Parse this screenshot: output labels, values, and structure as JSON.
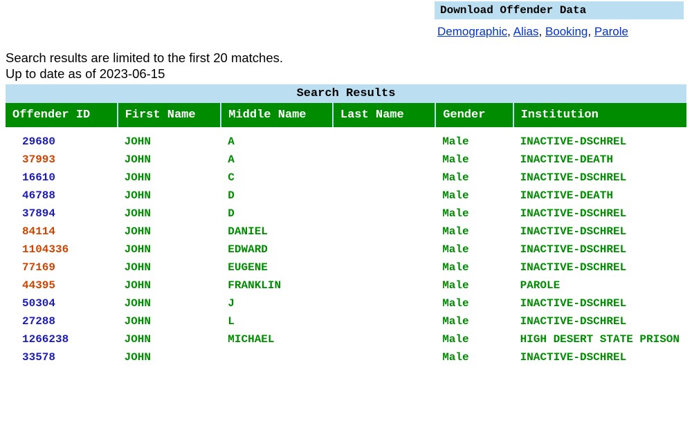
{
  "download": {
    "header": "Download Offender Data",
    "links": [
      {
        "label": "Demographic"
      },
      {
        "label": "Alias"
      },
      {
        "label": "Booking"
      },
      {
        "label": "Parole"
      }
    ]
  },
  "info": {
    "line1": "Search results are limited to the first 20 matches.",
    "line2": "Up to date as of 2023-06-15"
  },
  "results": {
    "title": "Search Results",
    "columns": [
      "Offender ID",
      "First Name",
      "Middle Name",
      "Last Name",
      "Gender",
      "Institution"
    ],
    "rows": [
      {
        "id": "29680",
        "color": "blue",
        "first": "JOHN",
        "middle": "A",
        "last": "",
        "gender": "Male",
        "inst": "INACTIVE-DSCHREL"
      },
      {
        "id": "37993",
        "color": "orange",
        "first": "JOHN",
        "middle": "A",
        "last": "",
        "gender": "Male",
        "inst": "INACTIVE-DEATH"
      },
      {
        "id": "16610",
        "color": "blue",
        "first": "JOHN",
        "middle": "C",
        "last": "",
        "gender": "Male",
        "inst": "INACTIVE-DSCHREL"
      },
      {
        "id": "46788",
        "color": "blue",
        "first": "JOHN",
        "middle": "D",
        "last": "",
        "gender": "Male",
        "inst": "INACTIVE-DEATH"
      },
      {
        "id": "37894",
        "color": "blue",
        "first": "JOHN",
        "middle": "D",
        "last": "",
        "gender": "Male",
        "inst": "INACTIVE-DSCHREL"
      },
      {
        "id": "84114",
        "color": "orange",
        "first": "JOHN",
        "middle": "DANIEL",
        "last": "",
        "gender": "Male",
        "inst": "INACTIVE-DSCHREL"
      },
      {
        "id": "1104336",
        "color": "orange",
        "first": "JOHN",
        "middle": "EDWARD",
        "last": "",
        "gender": "Male",
        "inst": "INACTIVE-DSCHREL"
      },
      {
        "id": "77169",
        "color": "orange",
        "first": "JOHN",
        "middle": "EUGENE",
        "last": "",
        "gender": "Male",
        "inst": "INACTIVE-DSCHREL"
      },
      {
        "id": "44395",
        "color": "orange",
        "first": "JOHN",
        "middle": "FRANKLIN",
        "last": "",
        "gender": "Male",
        "inst": "PAROLE"
      },
      {
        "id": "50304",
        "color": "blue",
        "first": "JOHN",
        "middle": "J",
        "last": "",
        "gender": "Male",
        "inst": "INACTIVE-DSCHREL"
      },
      {
        "id": "27288",
        "color": "blue",
        "first": "JOHN",
        "middle": "L",
        "last": "",
        "gender": "Male",
        "inst": "INACTIVE-DSCHREL"
      },
      {
        "id": "1266238",
        "color": "blue",
        "first": "JOHN",
        "middle": "MICHAEL",
        "last": "",
        "gender": "Male",
        "inst": "HIGH DESERT STATE PRISON"
      },
      {
        "id": "33578",
        "color": "blue",
        "first": "JOHN",
        "middle": "",
        "last": "",
        "gender": "Male",
        "inst": "INACTIVE-DSCHREL"
      }
    ]
  }
}
